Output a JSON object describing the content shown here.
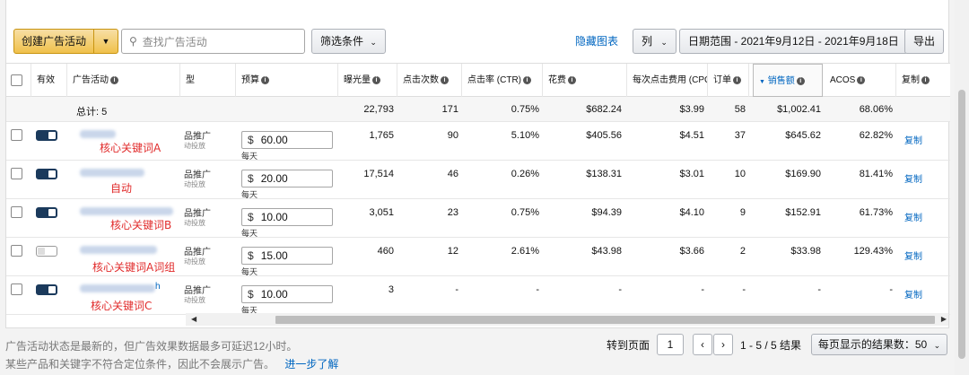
{
  "toolbar": {
    "create_label": "创建广告活动",
    "search_placeholder": "查找广告活动",
    "filter_label": "筛选条件",
    "hide_chart_label": "隐藏图表",
    "columns_label": "列",
    "date_range_label": "日期范围 - 2021年9月12日 - 2021年9月18日",
    "export_label": "导出"
  },
  "columns": {
    "active": "有效",
    "campaign": "广告活动",
    "type": "型",
    "budget": "预算",
    "impressions": "曝光量",
    "clicks": "点击次数",
    "ctr": "点击率 (CTR)",
    "spend": "花费",
    "cpc": "每次点击费用 (CPC)",
    "orders": "订单",
    "sales": "销售额",
    "acos": "ACOS",
    "copy": "复制"
  },
  "total": {
    "label": "总计: 5",
    "impressions": "22,793",
    "clicks": "171",
    "ctr": "0.75%",
    "spend": "$682.24",
    "cpc": "$3.99",
    "orders": "58",
    "sales": "$1,002.41",
    "acos": "68.06%"
  },
  "rows": [
    {
      "annotation": "核心关键词A",
      "type": "品推广",
      "type_sub": "动投放",
      "currency": "$",
      "budget": "60.00",
      "per_day": "每天",
      "impressions": "1,765",
      "clicks": "90",
      "ctr": "5.10%",
      "spend": "$405.56",
      "cpc": "$4.51",
      "orders": "37",
      "sales": "$645.62",
      "acos": "62.82%",
      "copy": "复制"
    },
    {
      "annotation": "自动",
      "type": "品推广",
      "type_sub": "动投放",
      "currency": "$",
      "budget": "20.00",
      "per_day": "每天",
      "impressions": "17,514",
      "clicks": "46",
      "ctr": "0.26%",
      "spend": "$138.31",
      "cpc": "$3.01",
      "orders": "10",
      "sales": "$169.90",
      "acos": "81.41%",
      "copy": "复制"
    },
    {
      "annotation": "核心关键词B",
      "type": "品推广",
      "type_sub": "动投放",
      "currency": "$",
      "budget": "10.00",
      "per_day": "每天",
      "impressions": "3,051",
      "clicks": "23",
      "ctr": "0.75%",
      "spend": "$94.39",
      "cpc": "$4.10",
      "orders": "9",
      "sales": "$152.91",
      "acos": "61.73%",
      "copy": "复制"
    },
    {
      "annotation": "核心关键词A词组",
      "type": "品推广",
      "type_sub": "动投放",
      "currency": "$",
      "budget": "15.00",
      "per_day": "每天",
      "impressions": "460",
      "clicks": "12",
      "ctr": "2.61%",
      "spend": "$43.98",
      "cpc": "$3.66",
      "orders": "2",
      "sales": "$33.98",
      "acos": "129.43%",
      "copy": "复制"
    },
    {
      "annotation": "核心关键词C",
      "name_suffix": "h",
      "type": "品推广",
      "type_sub": "动投放",
      "currency": "$",
      "budget": "10.00",
      "per_day": "每天",
      "impressions": "3",
      "clicks": "-",
      "ctr": "-",
      "spend": "-",
      "cpc": "-",
      "orders": "-",
      "sales": "-",
      "acos": "-",
      "copy": "复制"
    }
  ],
  "footer": {
    "note1": "广告活动状态是最新的，但广告效果数据最多可延迟12小时。",
    "note2": "某些产品和关键字不符合定位条件，因此不会展示广告。",
    "learn_more": "进一步了解",
    "goto_page": "转到页面",
    "page_value": "1",
    "results": "1 - 5 / 5 结果",
    "per_page": "每页显示的结果数：50"
  },
  "colors": {
    "accent": "#0066c0",
    "annotation": "#e12c2c",
    "button": "#f0c14b"
  }
}
